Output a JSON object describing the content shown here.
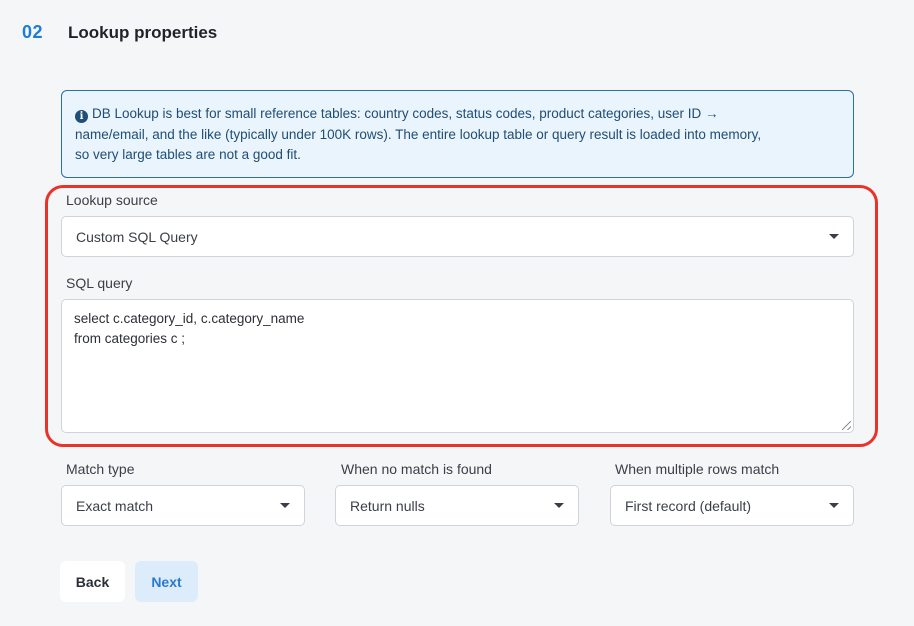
{
  "step": {
    "number": "02",
    "title": "Lookup properties"
  },
  "info": {
    "icon": "info-icon",
    "lines": [
      "DB Lookup is best for small reference tables: country codes, status codes, product categories, user ID →",
      "name/email, and the like (typically under 100K rows). The entire lookup table or query result is loaded into memory,",
      "so very large tables are not a good fit."
    ]
  },
  "lookup_source": {
    "label": "Lookup source",
    "value": "Custom SQL Query"
  },
  "sql_query": {
    "label": "SQL query",
    "lines": [
      "select c.category_id, c.category_name",
      "from categories c ;"
    ]
  },
  "match_type": {
    "label": "Match type",
    "value": "Exact match"
  },
  "no_match": {
    "label": "When no match is found",
    "value": "Return nulls"
  },
  "multiple_rows": {
    "label": "When multiple rows match",
    "value": "First record (default)"
  },
  "buttons": {
    "back": "Back",
    "next": "Next"
  },
  "colors": {
    "accent": "#1e7bd8",
    "highlight": "#e8332a",
    "info_bg": "#e9f4fc"
  }
}
